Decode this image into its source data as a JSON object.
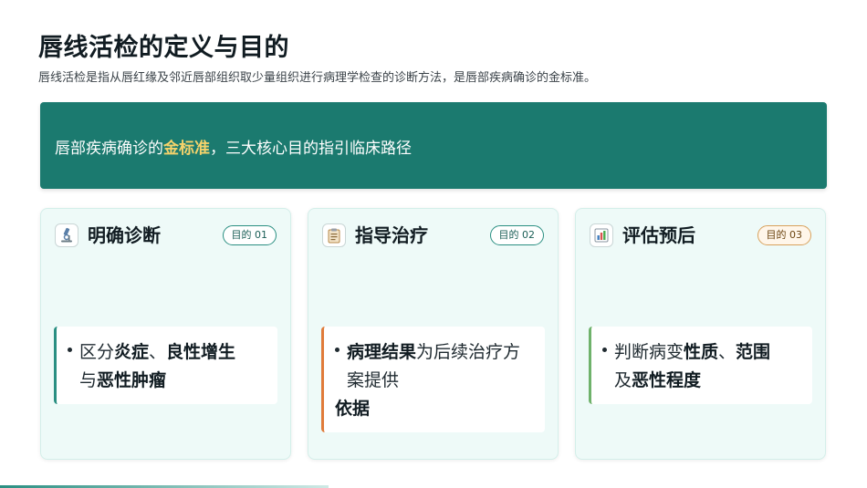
{
  "header": {
    "title": "唇线活检的定义与目的",
    "subtitle": "唇线活检是指从唇红缘及邻近唇部组织取少量组织进行病理学检查的诊断方法，是唇部疾病确诊的金标准。"
  },
  "banner": {
    "prefix": "唇部疾病确诊的",
    "highlight": "金标准",
    "suffix": "，三大核心目的指引临床路径"
  },
  "cards": [
    {
      "icon": "microscope-icon",
      "title": "明确诊断",
      "tag": "目的 01",
      "point": {
        "t1": "区分",
        "b1": "炎症",
        "t2": "、",
        "b2": "良性增生",
        "t3": "与",
        "b3": "恶性肿瘤"
      }
    },
    {
      "icon": "clipboard-icon",
      "title": "指导治疗",
      "tag": "目的 02",
      "point": {
        "b1": "病理结果",
        "t1": "为后续治疗方",
        "t2": "案提供",
        "b2": "依据"
      }
    },
    {
      "icon": "bar-chart-icon",
      "title": "评估预后",
      "tag": "目的 03",
      "point": {
        "t1": "判断病变",
        "b1": "性质",
        "t2": "、",
        "b2": "范围",
        "t3": "及",
        "b3": "恶性程度"
      }
    }
  ],
  "colors": {
    "banner": "#1b7a6f",
    "highlight": "#f5d36b",
    "card_bg": "#eefaf8",
    "accent_teal": "#2a8f82",
    "accent_orange": "#e07b3a",
    "accent_green": "#6fb26b"
  }
}
